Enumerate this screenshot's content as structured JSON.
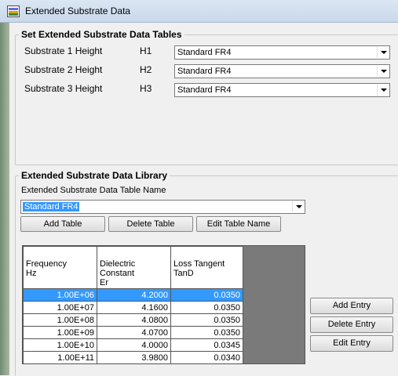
{
  "window": {
    "title": "Extended Substrate Data"
  },
  "set_tables": {
    "legend": "Set Extended Substrate Data Tables",
    "rows": [
      {
        "label": "Substrate 1 Height",
        "code": "H1",
        "value": "Standard FR4"
      },
      {
        "label": "Substrate 2 Height",
        "code": "H2",
        "value": "Standard FR4"
      },
      {
        "label": "Substrate 3 Height",
        "code": "H3",
        "value": "Standard FR4"
      }
    ]
  },
  "library": {
    "legend": "Extended Substrate Data Library",
    "table_name_label": "Extended Substrate Data Table Name",
    "table_name_value": "Standard FR4",
    "buttons": {
      "add_table": "Add Table",
      "delete_table": "Delete Table",
      "edit_table_name": "Edit Table Name"
    },
    "grid": {
      "headers": [
        {
          "line1": "Frequency",
          "line2": "Hz"
        },
        {
          "line1": "Dielectric Constant",
          "line2": "Er"
        },
        {
          "line1": "Loss Tangent",
          "line2": "TanD"
        }
      ],
      "rows": [
        [
          "1.00E+06",
          "4.2000",
          "0.0350"
        ],
        [
          "1.00E+07",
          "4.1600",
          "0.0350"
        ],
        [
          "1.00E+08",
          "4.0800",
          "0.0350"
        ],
        [
          "1.00E+09",
          "4.0700",
          "0.0350"
        ],
        [
          "1.00E+10",
          "4.0000",
          "0.0345"
        ],
        [
          "1.00E+11",
          "3.9800",
          "0.0340"
        ]
      ],
      "selected_row": 0
    },
    "entry_buttons": {
      "add_entry": "Add Entry",
      "delete_entry": "Delete Entry",
      "edit_entry": "Edit Entry"
    }
  },
  "colors": {
    "selection": "#3399ff",
    "grid_background": "#7a7a7a"
  }
}
